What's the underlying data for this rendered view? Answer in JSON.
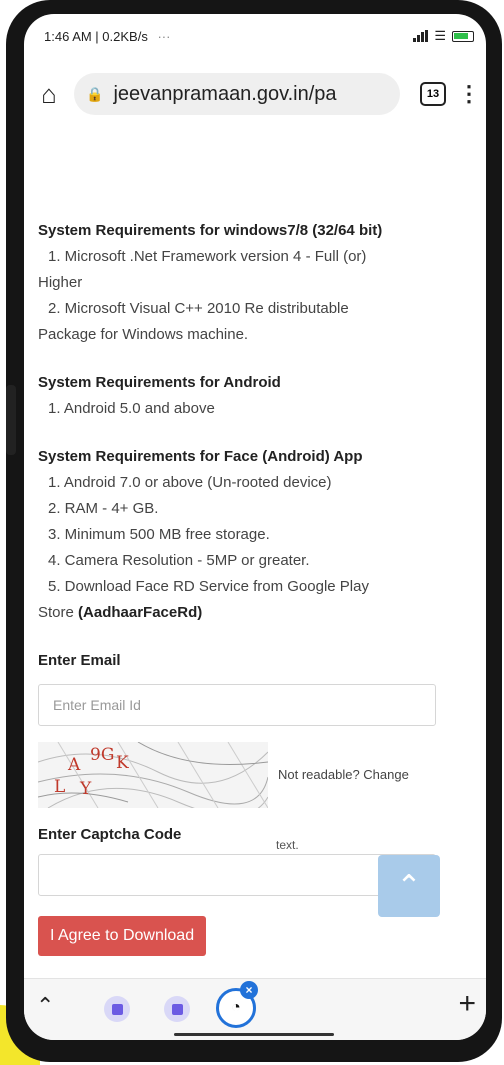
{
  "status_bar": {
    "time_info": "1:46 AM | 0.2KB/s",
    "extra": "···"
  },
  "browser": {
    "url": "jeevanpramaan.gov.in/pa",
    "tab_count": "13"
  },
  "sections": [
    {
      "title": "System Requirements for windows7/8 (32/64 bit)",
      "lines": [
        "1. Microsoft .Net Framework version 4 - Full (or)",
        "Higher",
        "2. Microsoft Visual C++ 2010 Re distributable",
        "Package for Windows machine."
      ]
    },
    {
      "title": "System Requirements for Android",
      "lines": [
        "1. Android 5.0 and above"
      ]
    },
    {
      "title": "System Requirements for Face (Android) App",
      "lines": [
        "1. Android 7.0 or above (Un-rooted device)",
        "2. RAM - 4+ GB.",
        "3. Minimum 500 MB free storage.",
        "4. Camera Resolution - 5MP or greater.",
        "5. Download Face RD Service from Google Play"
      ],
      "last_line_prefix": "Store ",
      "last_line_bold": "(AadhaarFaceRd)"
    }
  ],
  "form": {
    "email_label": "Enter Email",
    "email_placeholder": "Enter Email Id",
    "captcha_chars": [
      "A",
      "9G",
      "K",
      "L",
      "Y"
    ],
    "not_readable": "Not readable? Change",
    "text_suffix": "text.",
    "captcha_label": "Enter Captcha Code",
    "agree_button": "I Agree to Download"
  },
  "colors": {
    "agree_button": "#d9534f",
    "scroll_top": "#a9cbea",
    "active_tab_ring": "#2272d9"
  },
  "icons": [
    "home-icon",
    "lock-icon",
    "tabs-icon",
    "menu-icon",
    "chevron-up-icon",
    "plus-icon",
    "scroll-top-icon"
  ]
}
